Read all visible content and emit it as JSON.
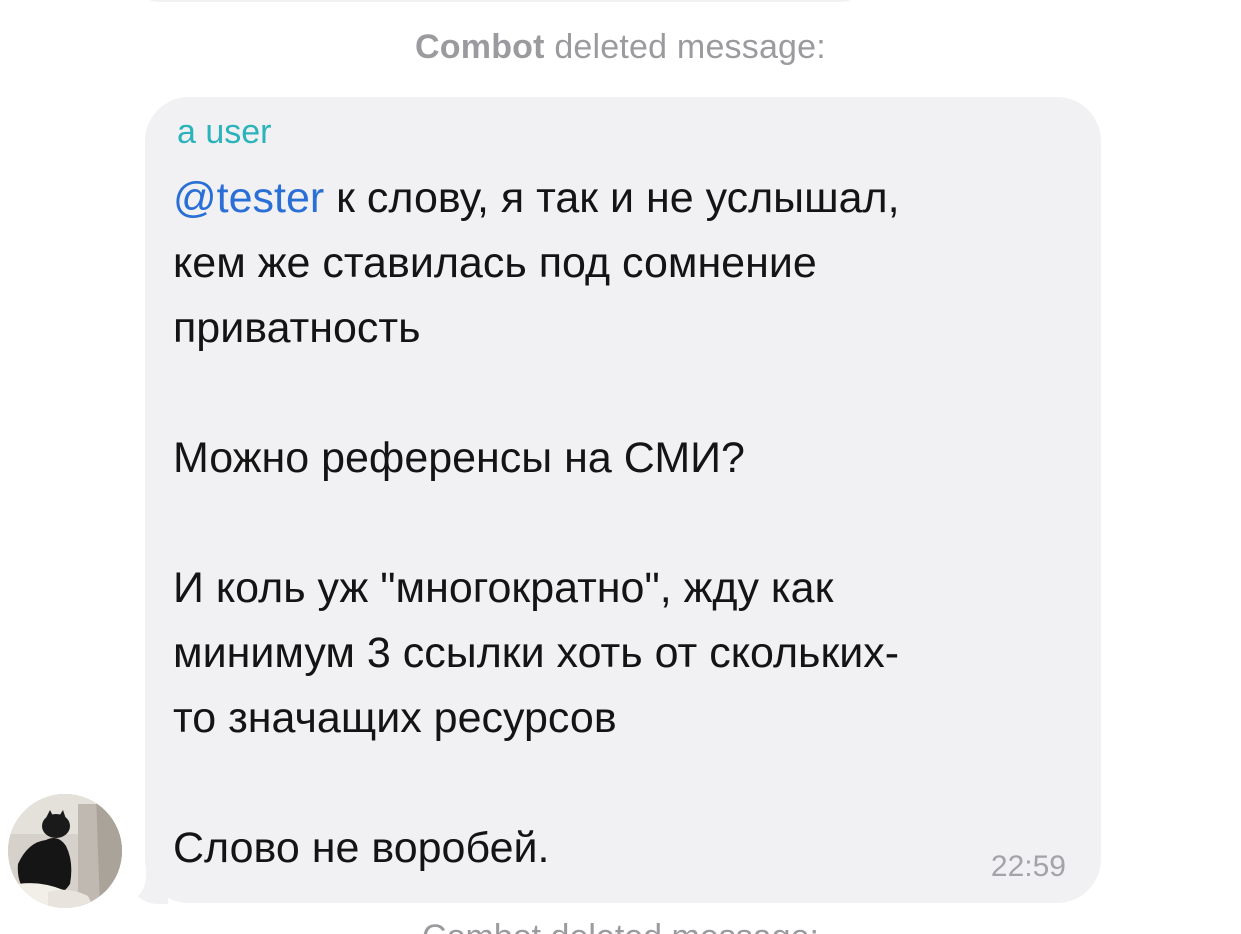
{
  "service_message": {
    "actor": "Combot",
    "action": "deleted message:"
  },
  "message": {
    "sender": "a user",
    "mention": "@tester",
    "text_after_mention": " к слову, я так и не услышал,\nкем же ставилась под сомнение\nприватность\n\nМожно референсы на СМИ?\n\nИ коль уж \"многократно\", жду как\nминимум 3 ссылки хоть от скольких-\nто значащих ресурсов\n\nСлово не воробей.",
    "time": "22:59"
  },
  "next_service_message": {
    "text": "Combot deleted message:"
  },
  "colors": {
    "bubble": "#f1f1f4",
    "sender": "#2bb3bb",
    "mention": "#2a6fd6",
    "service_text": "#9b9b9f"
  }
}
